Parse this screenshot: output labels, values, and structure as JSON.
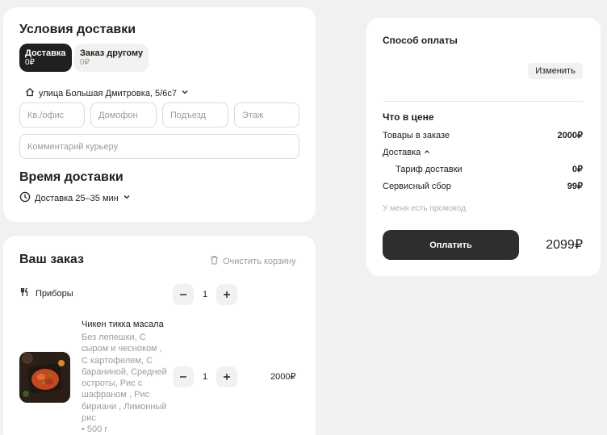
{
  "delivery": {
    "title": "Условия доставки",
    "modes": [
      {
        "label": "Доставка",
        "price": "0₽"
      },
      {
        "label": "Заказ другому",
        "price": "0₽"
      }
    ],
    "address": "улица Большая Дмитровка, 5/6с7",
    "fields": {
      "apartment": "Кв./офис",
      "intercom": "Домофон",
      "entrance": "Подъезд",
      "floor": "Этаж",
      "comment": "Комментарий курьеру"
    },
    "time_title": "Время доставки",
    "time_value": "Доставка 25–35 мин"
  },
  "order": {
    "title": "Ваш заказ",
    "clear_label": "Очистить корзину",
    "utensils_label": "Приборы",
    "utensils_qty": "1",
    "item": {
      "name": "Чикен тикка масала",
      "description": "Без лепешки, С сыром и чесноком , С картофелем, С бараниной, Средней остроты, Рис с шафраном , Рис бириани , Лимонный рис",
      "weight": "• 500 г",
      "qty": "1",
      "price": "2000₽"
    }
  },
  "payment": {
    "title": "Способ оплаты",
    "change_label": "Изменить",
    "price_heading": "Что в цене",
    "rows": {
      "goods": {
        "label": "Товары в заказе",
        "value": "2000₽"
      },
      "delivery": {
        "label": "Доставка"
      },
      "tariff": {
        "label": "Тариф доставки",
        "value": "0₽"
      },
      "service": {
        "label": "Сервисный сбор",
        "value": "99₽"
      }
    },
    "promo_label": "У меня есть промокод",
    "pay_label": "Оплатить",
    "total": "2099₽"
  },
  "colors": {
    "accent": "#21201f",
    "muted": "#9e9b98",
    "background": "#f2f1ef"
  }
}
